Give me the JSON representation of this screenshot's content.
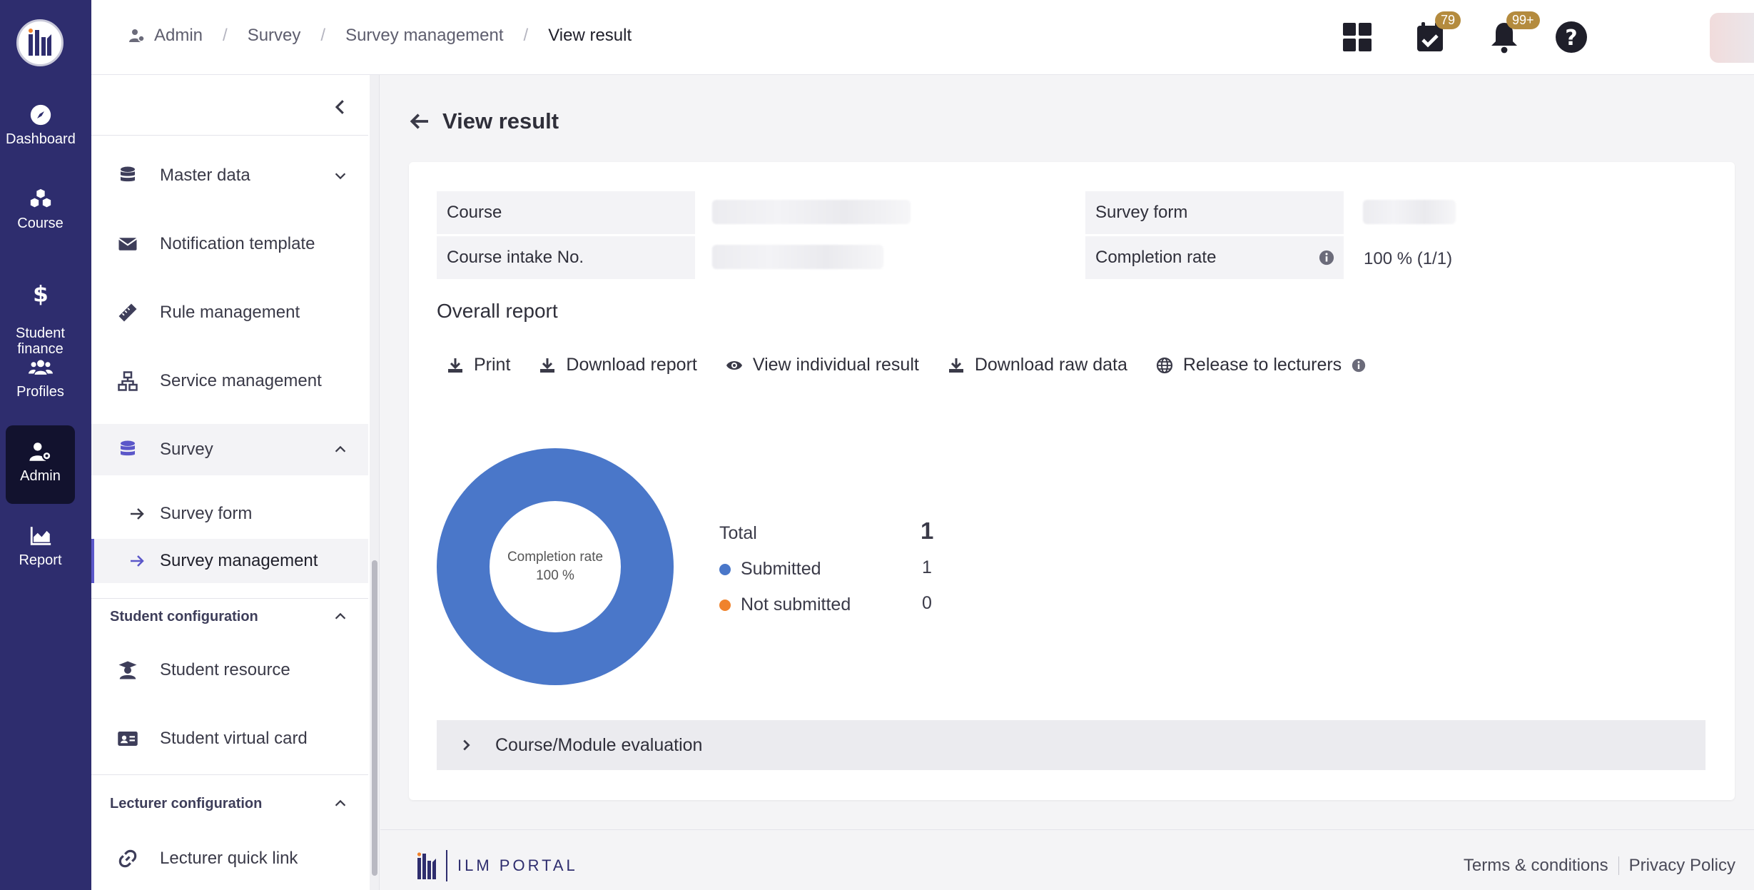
{
  "rail": {
    "items": [
      {
        "label": "Dashboard",
        "icon": "compass-icon"
      },
      {
        "label": "Course",
        "icon": "cubes-icon"
      },
      {
        "label": "Student\nfinance",
        "icon": "dollar-icon"
      },
      {
        "label": "Profiles",
        "icon": "users-icon"
      },
      {
        "label": "Admin",
        "icon": "user-gear-icon",
        "active": true
      },
      {
        "label": "Report",
        "icon": "chart-area-icon"
      }
    ]
  },
  "breadcrumb": {
    "items": [
      "Admin",
      "Survey",
      "Survey management",
      "View result"
    ]
  },
  "topbar": {
    "tasks_badge": "79",
    "notifications_badge": "99+"
  },
  "sidebar": {
    "items": [
      {
        "label": "Master data"
      },
      {
        "label": "Notification template"
      },
      {
        "label": "Rule management"
      },
      {
        "label": "Service management"
      },
      {
        "label": "Survey"
      }
    ],
    "survey_sub": [
      {
        "label": "Survey form"
      },
      {
        "label": "Survey management",
        "active": true
      }
    ],
    "student_config": {
      "heading": "Student configuration",
      "items": [
        {
          "label": "Student resource"
        },
        {
          "label": "Student virtual card"
        }
      ]
    },
    "lecturer_config": {
      "heading": "Lecturer configuration",
      "items": [
        {
          "label": "Lecturer quick link"
        }
      ]
    }
  },
  "page": {
    "title": "View result"
  },
  "info": {
    "course_label": "Course",
    "intake_label": "Course intake No.",
    "survey_form_label": "Survey form",
    "completion_label": "Completion rate",
    "completion_value": "100 % (1/1)"
  },
  "report": {
    "title": "Overall report",
    "actions": {
      "print": "Print",
      "download_report": "Download report",
      "view_individual": "View individual result",
      "download_raw": "Download raw data",
      "release": "Release to lecturers"
    },
    "donut_center_line1": "Completion rate",
    "donut_center_line2": "100 %",
    "total_label": "Total",
    "total_value": "1",
    "submitted_label": "Submitted",
    "submitted_value": "1",
    "not_submitted_label": "Not submitted",
    "not_submitted_value": "0",
    "colors": {
      "submitted": "#4a77c9",
      "not_submitted": "#f0822c"
    },
    "expander_label": "Course/Module evaluation"
  },
  "chart_data": {
    "type": "pie",
    "categories": [
      "Submitted",
      "Not submitted"
    ],
    "values": [
      1,
      0
    ],
    "title": ""
  },
  "footer": {
    "brand": "ILM PORTAL",
    "terms": "Terms & conditions",
    "privacy": "Privacy Policy"
  }
}
